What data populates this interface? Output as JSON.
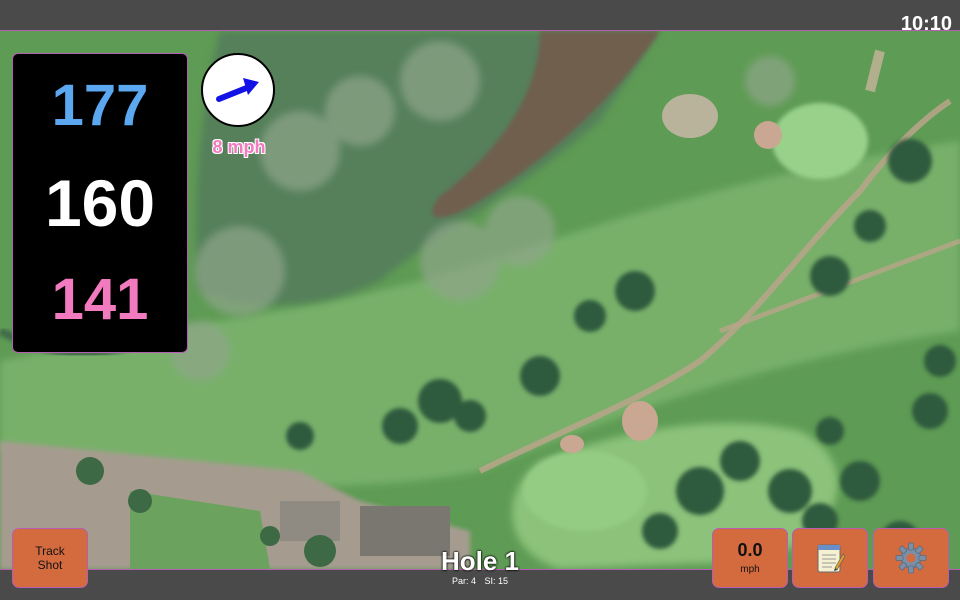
{
  "status_bar": {
    "time": "10:10"
  },
  "distances": {
    "back": "177",
    "middle": "160",
    "front": "141"
  },
  "wind": {
    "speed_label": "8 mph",
    "direction_icon": "arrow-east-northeast-icon"
  },
  "hole": {
    "title": "Hole 1",
    "par_label": "Par: 4",
    "si_label": "SI: 15"
  },
  "buttons": {
    "track_shot_line1": "Track",
    "track_shot_line2": "Shot",
    "speed_value": "0.0",
    "speed_unit": "mph",
    "notes_icon": "notepad-icon",
    "settings_icon": "gear-icon"
  },
  "colors": {
    "back_distance": "#5ba7f0",
    "middle_distance": "#ffffff",
    "front_distance": "#f27bbf",
    "button_bg": "#d46b3f",
    "bar_bg": "#4a4a4a",
    "accent_border": "#b45fb4"
  }
}
